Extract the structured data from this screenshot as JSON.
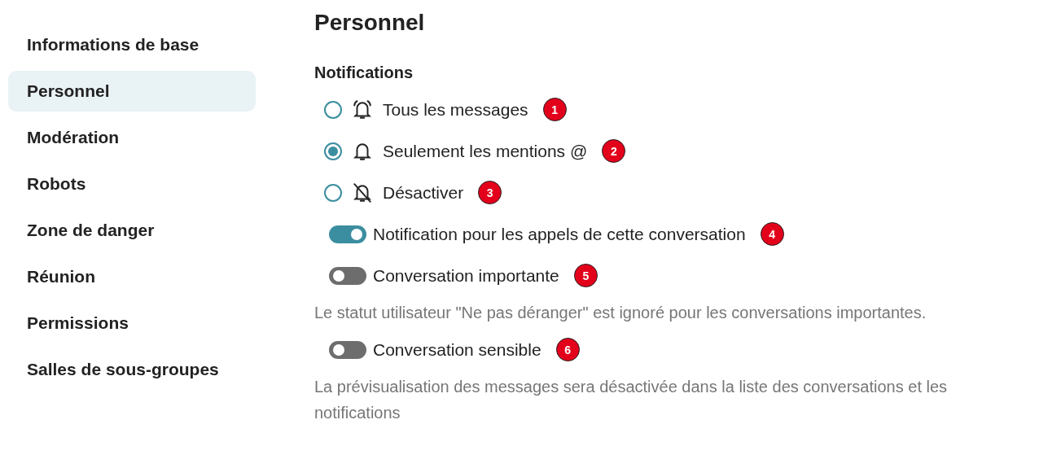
{
  "sidebar": {
    "items": [
      {
        "label": "Informations de base",
        "selected": false
      },
      {
        "label": "Personnel",
        "selected": true
      },
      {
        "label": "Modération",
        "selected": false
      },
      {
        "label": "Robots",
        "selected": false
      },
      {
        "label": "Zone de danger",
        "selected": false
      },
      {
        "label": "Réunion",
        "selected": false
      },
      {
        "label": "Permissions",
        "selected": false
      },
      {
        "label": "Salles de sous-groupes",
        "selected": false
      }
    ]
  },
  "title": "Personnel",
  "section": "Notifications",
  "settings": [
    {
      "kind": "radio",
      "label": "Tous les messages",
      "selected": false,
      "badge": "1"
    },
    {
      "kind": "radio",
      "label": "Seulement les mentions @",
      "selected": true,
      "badge": "2"
    },
    {
      "kind": "radio",
      "label": "Désactiver",
      "selected": false,
      "badge": "3"
    },
    {
      "kind": "toggle",
      "label": "Notification pour les appels de cette conversation",
      "on": true,
      "badge": "4"
    },
    {
      "kind": "toggle",
      "label": "Conversation importante",
      "on": false,
      "badge": "5"
    },
    {
      "kind": "note",
      "text": "Le statut utilisateur \"Ne pas déranger\" est ignoré pour les conversations importantes."
    },
    {
      "kind": "toggle",
      "label": "Conversation sensible",
      "on": false,
      "badge": "6"
    },
    {
      "kind": "note",
      "text": "La prévisualisation des messages sera désactivée dans la liste des conversations et les notifications"
    }
  ]
}
